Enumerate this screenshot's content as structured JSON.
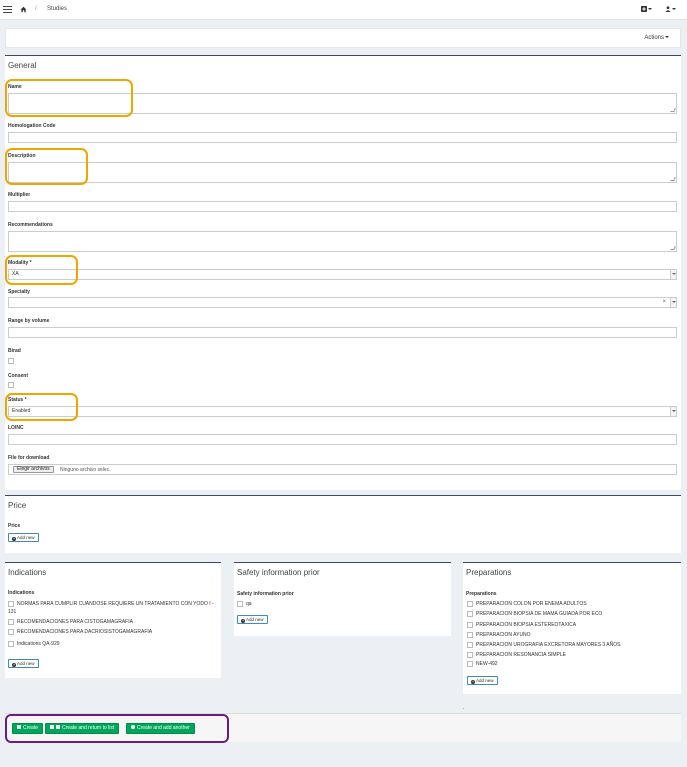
{
  "breadcrumb": {
    "separator": "/",
    "current": "Studies"
  },
  "actions": {
    "label": "Actions"
  },
  "general": {
    "title": "General",
    "fields": {
      "name": {
        "label": "Name",
        "value": ""
      },
      "homologation_code": {
        "label": "Homologation Code",
        "value": ""
      },
      "description": {
        "label": "Description",
        "value": ""
      },
      "multiplier": {
        "label": "Multiplier",
        "value": ""
      },
      "recommendations": {
        "label": "Recommendations",
        "value": ""
      },
      "modality": {
        "label": "Modality *",
        "value": "XA"
      },
      "specialty": {
        "label": "Specialty",
        "value": "",
        "clear": "×"
      },
      "range_by_volume": {
        "label": "Range by volume",
        "value": ""
      },
      "birad": {
        "label": "Birad"
      },
      "consent": {
        "label": "Consent"
      },
      "status": {
        "label": "Status *",
        "value": "Enabled"
      },
      "loinc": {
        "label": "LOINC",
        "value": ""
      },
      "file_for_download": {
        "label": "File for download",
        "button": "Elegir archivos",
        "status": "Ninguno archivo selec."
      }
    }
  },
  "price": {
    "title": "Price",
    "label": "Price",
    "add_label": "Add new"
  },
  "indications": {
    "title": "Indications",
    "label": "Indications",
    "items": [
      "NORMAS PARA CUMPLIR CUANDOSE REQUIERE UN TRATAMIENTO CON YODO I -",
      "131",
      "RECOMENDACIONES PARA CISTOGAMAGRAFIA",
      "RECOMENDACIONES PARA DACRIOSISTOGAMAGRAFIA",
      "Indications QA-929"
    ],
    "add_label": "Add new"
  },
  "safety": {
    "title": "Safety information prior",
    "label": "Safety information prior",
    "items": [
      "qa"
    ],
    "add_label": "Add new"
  },
  "preparations": {
    "title": "Preparations",
    "label": "Preparations",
    "items": [
      "PREPARACION COLON POR ENEMA ADULTOS",
      "PREPARACION BIOPSIA DE MAMA GUIADA POR ECO",
      "PREPARACION BIOPSIA ESTEREOTAXICA",
      "PREPARACION AYUNO",
      "PREPARACION UROGRAFIA EXCRETORA MAYORES 3 AÑOS",
      "PREPARACION RESONANCIA SIMPLE",
      "NEW-492"
    ],
    "add_label": "Add new"
  },
  "footer": {
    "create": "Create",
    "create_return": "Create and return to list",
    "create_another": "Create and add another",
    "dot": "."
  },
  "colors": {
    "primary_green": "#00a65a",
    "highlight_orange": "#f0a500",
    "highlight_purple": "#6a1b8a",
    "box_border": "#3c4b5b"
  }
}
